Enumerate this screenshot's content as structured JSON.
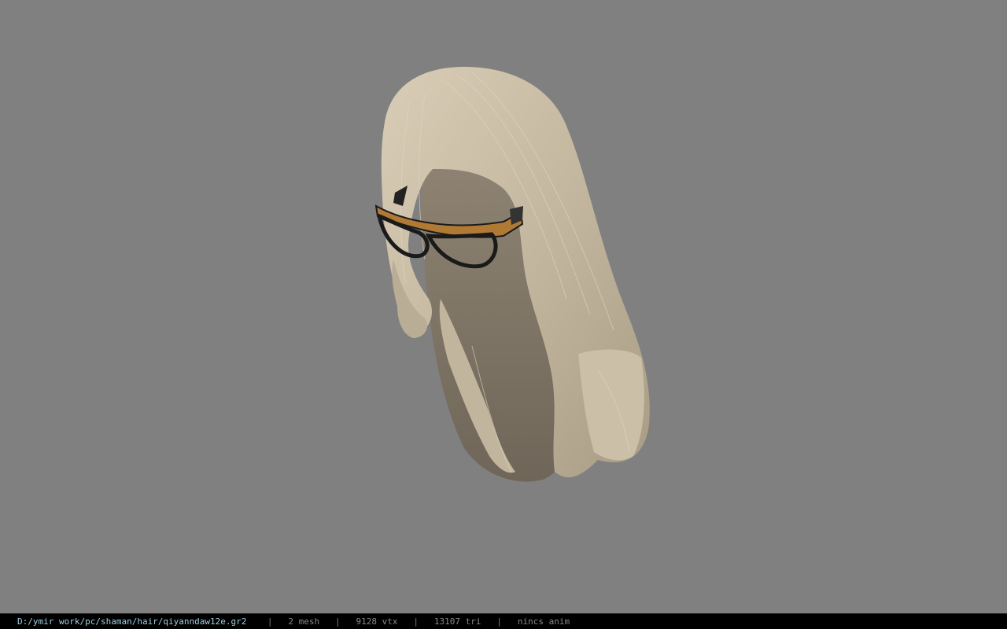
{
  "viewer": {
    "background_color": "#808080",
    "model": {
      "description_icon": "hair-mesh-with-glasses",
      "hair_color": "#c9bda7",
      "glasses_frame_color": "#1a1a1a",
      "glasses_accent_color": "#b07a35"
    }
  },
  "status_bar": {
    "file_path": "D:/ymir work/pc/shaman/hair/qiyanndaw12e.gr2",
    "separator": "|",
    "mesh_count": "2 mesh",
    "vertex_count": "9128 vtx",
    "triangle_count": "13107 tri",
    "anim_status": "nincs anim",
    "path_color": "#9fd0e0",
    "text_color": "#8a8a8a"
  }
}
